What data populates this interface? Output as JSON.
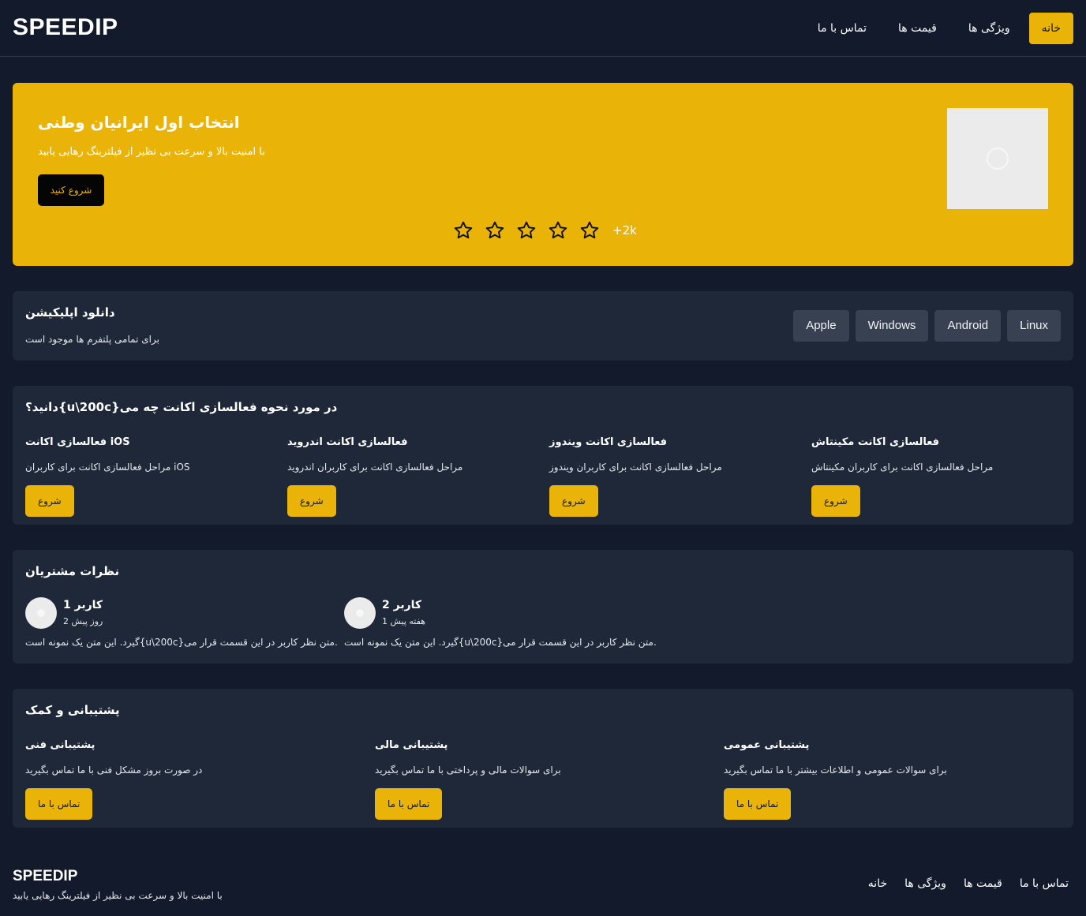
{
  "header": {
    "logo": "SPEEDIP",
    "nav": [
      "خانه",
      "ویژگی ها",
      "قیمت ها",
      "تماس با ما"
    ]
  },
  "hero": {
    "title": "انتخاب اول ایرانیان وطنی",
    "subtitle": "با امنیت بالا و سرعت بی نظیر از فیلترینگ رهایی یابید",
    "cta": "شروع کنید",
    "rating_count": "+2k",
    "stars": 5,
    "image_icon": "image-placeholder-icon"
  },
  "download": {
    "title": "دانلود اپلیکیشن",
    "subtitle": "برای تمامی پلتفرم ها موجود است",
    "platforms": [
      "Linux",
      "Android",
      "Windows",
      "Apple"
    ]
  },
  "activation": {
    "title": "دانید؟{u\\200c}در مورد نحوه فعالسازی اکانت چه می",
    "items": [
      {
        "title": "فعالسازی اکانت iOS",
        "desc": "مراحل فعالسازی اکانت برای کاربران iOS",
        "button": "شروع"
      },
      {
        "title": "فعالسازی اکانت اندروید",
        "desc": "مراحل فعالسازی اکانت برای کاربران اندروید",
        "button": "شروع"
      },
      {
        "title": "فعالسازی اکانت ویندوز",
        "desc": "مراحل فعالسازی اکانت برای کاربران ویندوز",
        "button": "شروع"
      },
      {
        "title": "فعالسازی اکانت مکینتاش",
        "desc": "مراحل فعالسازی اکانت برای کاربران مکینتاش",
        "button": "شروع"
      }
    ]
  },
  "reviews": {
    "title": "نظرات مشتریان",
    "items": [
      {
        "name": "کاربر 1",
        "time": "2 روز پیش",
        "text": "گیرد. این متن یک نمونه است{u\\200c}متن نظر کاربر در این قسمت قرار می."
      },
      {
        "name": "کاربر 2",
        "time": "1 هفته پیش",
        "text": "گیرد. این متن یک نمونه است{u\\200c}متن نظر کاربر در این قسمت قرار می."
      }
    ]
  },
  "support": {
    "title": "پشتیبانی و کمک",
    "items": [
      {
        "title": "پشتیبانی فنی",
        "desc": "در صورت بروز مشکل فنی با ما تماس بگیرید",
        "button": "تماس با ما"
      },
      {
        "title": "پشتیبانی مالی",
        "desc": "برای سوالات مالی و پرداختی با ما تماس بگیرید",
        "button": "تماس با ما"
      },
      {
        "title": "پشتیبانی عمومی",
        "desc": "برای سوالات عمومی و اطلاعات بیشتر با ما تماس بگیرید",
        "button": "تماس با ما"
      }
    ]
  },
  "footer": {
    "logo": "SPEEDIP",
    "subtitle": "با امنیت بالا و سرعت بی نظیر از فیلترینگ رهایی یابید",
    "nav": [
      "تماس با ما",
      "قیمت ها",
      "ویژگی ها",
      "خانه"
    ]
  },
  "colors": {
    "background": "#121a2b",
    "card": "#1f2839",
    "accent": "#e9b308",
    "platform_button": "#374151"
  }
}
